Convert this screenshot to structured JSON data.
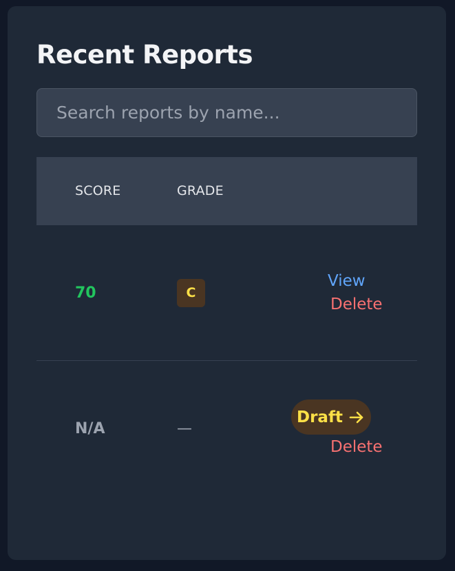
{
  "header": {
    "title": "Recent Reports"
  },
  "search": {
    "placeholder": "Search reports by name...",
    "value": ""
  },
  "table": {
    "columns": [
      "SCORE",
      "GRADE"
    ],
    "rows": [
      {
        "score": "70",
        "grade": "C",
        "actions": {
          "view_label": "View",
          "delete_label": "Delete"
        }
      },
      {
        "score": "N/A",
        "grade": "—",
        "actions": {
          "draft_label": "Draft",
          "draft_icon": "arrow-right-icon",
          "delete_label": "Delete"
        }
      }
    ]
  },
  "colors": {
    "background": "#111827",
    "card": "#1f2937",
    "header_row": "#374151",
    "score_good": "#22c55e",
    "score_na": "#9ca3af",
    "badge_bg": "#4a3522",
    "badge_text": "#fde047",
    "link_view": "#60a5fa",
    "link_delete": "#f87171"
  }
}
